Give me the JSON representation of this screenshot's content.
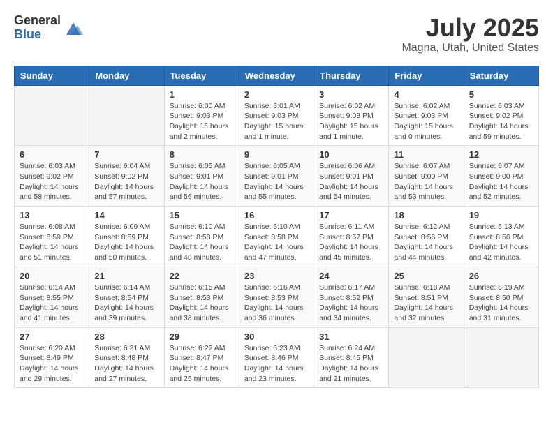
{
  "logo": {
    "general": "General",
    "blue": "Blue"
  },
  "title": "July 2025",
  "subtitle": "Magna, Utah, United States",
  "weekdays": [
    "Sunday",
    "Monday",
    "Tuesday",
    "Wednesday",
    "Thursday",
    "Friday",
    "Saturday"
  ],
  "weeks": [
    [
      {
        "day": "",
        "sunrise": "",
        "sunset": "",
        "daylight": ""
      },
      {
        "day": "",
        "sunrise": "",
        "sunset": "",
        "daylight": ""
      },
      {
        "day": "1",
        "sunrise": "Sunrise: 6:00 AM",
        "sunset": "Sunset: 9:03 PM",
        "daylight": "Daylight: 15 hours and 2 minutes."
      },
      {
        "day": "2",
        "sunrise": "Sunrise: 6:01 AM",
        "sunset": "Sunset: 9:03 PM",
        "daylight": "Daylight: 15 hours and 1 minute."
      },
      {
        "day": "3",
        "sunrise": "Sunrise: 6:02 AM",
        "sunset": "Sunset: 9:03 PM",
        "daylight": "Daylight: 15 hours and 1 minute."
      },
      {
        "day": "4",
        "sunrise": "Sunrise: 6:02 AM",
        "sunset": "Sunset: 9:03 PM",
        "daylight": "Daylight: 15 hours and 0 minutes."
      },
      {
        "day": "5",
        "sunrise": "Sunrise: 6:03 AM",
        "sunset": "Sunset: 9:02 PM",
        "daylight": "Daylight: 14 hours and 59 minutes."
      }
    ],
    [
      {
        "day": "6",
        "sunrise": "Sunrise: 6:03 AM",
        "sunset": "Sunset: 9:02 PM",
        "daylight": "Daylight: 14 hours and 58 minutes."
      },
      {
        "day": "7",
        "sunrise": "Sunrise: 6:04 AM",
        "sunset": "Sunset: 9:02 PM",
        "daylight": "Daylight: 14 hours and 57 minutes."
      },
      {
        "day": "8",
        "sunrise": "Sunrise: 6:05 AM",
        "sunset": "Sunset: 9:01 PM",
        "daylight": "Daylight: 14 hours and 56 minutes."
      },
      {
        "day": "9",
        "sunrise": "Sunrise: 6:05 AM",
        "sunset": "Sunset: 9:01 PM",
        "daylight": "Daylight: 14 hours and 55 minutes."
      },
      {
        "day": "10",
        "sunrise": "Sunrise: 6:06 AM",
        "sunset": "Sunset: 9:01 PM",
        "daylight": "Daylight: 14 hours and 54 minutes."
      },
      {
        "day": "11",
        "sunrise": "Sunrise: 6:07 AM",
        "sunset": "Sunset: 9:00 PM",
        "daylight": "Daylight: 14 hours and 53 minutes."
      },
      {
        "day": "12",
        "sunrise": "Sunrise: 6:07 AM",
        "sunset": "Sunset: 9:00 PM",
        "daylight": "Daylight: 14 hours and 52 minutes."
      }
    ],
    [
      {
        "day": "13",
        "sunrise": "Sunrise: 6:08 AM",
        "sunset": "Sunset: 8:59 PM",
        "daylight": "Daylight: 14 hours and 51 minutes."
      },
      {
        "day": "14",
        "sunrise": "Sunrise: 6:09 AM",
        "sunset": "Sunset: 8:59 PM",
        "daylight": "Daylight: 14 hours and 50 minutes."
      },
      {
        "day": "15",
        "sunrise": "Sunrise: 6:10 AM",
        "sunset": "Sunset: 8:58 PM",
        "daylight": "Daylight: 14 hours and 48 minutes."
      },
      {
        "day": "16",
        "sunrise": "Sunrise: 6:10 AM",
        "sunset": "Sunset: 8:58 PM",
        "daylight": "Daylight: 14 hours and 47 minutes."
      },
      {
        "day": "17",
        "sunrise": "Sunrise: 6:11 AM",
        "sunset": "Sunset: 8:57 PM",
        "daylight": "Daylight: 14 hours and 45 minutes."
      },
      {
        "day": "18",
        "sunrise": "Sunrise: 6:12 AM",
        "sunset": "Sunset: 8:56 PM",
        "daylight": "Daylight: 14 hours and 44 minutes."
      },
      {
        "day": "19",
        "sunrise": "Sunrise: 6:13 AM",
        "sunset": "Sunset: 8:56 PM",
        "daylight": "Daylight: 14 hours and 42 minutes."
      }
    ],
    [
      {
        "day": "20",
        "sunrise": "Sunrise: 6:14 AM",
        "sunset": "Sunset: 8:55 PM",
        "daylight": "Daylight: 14 hours and 41 minutes."
      },
      {
        "day": "21",
        "sunrise": "Sunrise: 6:14 AM",
        "sunset": "Sunset: 8:54 PM",
        "daylight": "Daylight: 14 hours and 39 minutes."
      },
      {
        "day": "22",
        "sunrise": "Sunrise: 6:15 AM",
        "sunset": "Sunset: 8:53 PM",
        "daylight": "Daylight: 14 hours and 38 minutes."
      },
      {
        "day": "23",
        "sunrise": "Sunrise: 6:16 AM",
        "sunset": "Sunset: 8:53 PM",
        "daylight": "Daylight: 14 hours and 36 minutes."
      },
      {
        "day": "24",
        "sunrise": "Sunrise: 6:17 AM",
        "sunset": "Sunset: 8:52 PM",
        "daylight": "Daylight: 14 hours and 34 minutes."
      },
      {
        "day": "25",
        "sunrise": "Sunrise: 6:18 AM",
        "sunset": "Sunset: 8:51 PM",
        "daylight": "Daylight: 14 hours and 32 minutes."
      },
      {
        "day": "26",
        "sunrise": "Sunrise: 6:19 AM",
        "sunset": "Sunset: 8:50 PM",
        "daylight": "Daylight: 14 hours and 31 minutes."
      }
    ],
    [
      {
        "day": "27",
        "sunrise": "Sunrise: 6:20 AM",
        "sunset": "Sunset: 8:49 PM",
        "daylight": "Daylight: 14 hours and 29 minutes."
      },
      {
        "day": "28",
        "sunrise": "Sunrise: 6:21 AM",
        "sunset": "Sunset: 8:48 PM",
        "daylight": "Daylight: 14 hours and 27 minutes."
      },
      {
        "day": "29",
        "sunrise": "Sunrise: 6:22 AM",
        "sunset": "Sunset: 8:47 PM",
        "daylight": "Daylight: 14 hours and 25 minutes."
      },
      {
        "day": "30",
        "sunrise": "Sunrise: 6:23 AM",
        "sunset": "Sunset: 8:46 PM",
        "daylight": "Daylight: 14 hours and 23 minutes."
      },
      {
        "day": "31",
        "sunrise": "Sunrise: 6:24 AM",
        "sunset": "Sunset: 8:45 PM",
        "daylight": "Daylight: 14 hours and 21 minutes."
      },
      {
        "day": "",
        "sunrise": "",
        "sunset": "",
        "daylight": ""
      },
      {
        "day": "",
        "sunrise": "",
        "sunset": "",
        "daylight": ""
      }
    ]
  ]
}
